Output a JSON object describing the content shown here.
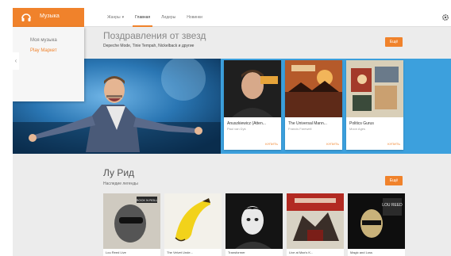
{
  "app": {
    "name": "Музыка",
    "icon": "headphones-icon"
  },
  "nav": {
    "tabs": [
      {
        "label": "Жанры",
        "caret": "▾"
      },
      {
        "label": "Главная",
        "active": true
      },
      {
        "label": "Лидеры"
      },
      {
        "label": "Новинки"
      }
    ]
  },
  "sidemenu": {
    "items": [
      "Моя музыка",
      "Play Маркет"
    ]
  },
  "collapse_glyph": "‹",
  "featured": {
    "title": "Поздравления от звезд",
    "subtitle": "Depeche Mode, Tinie Tempah, Nickelback и другие",
    "more_label": "Ещё",
    "albums": [
      {
        "title": "Anuszkiewicz (Atten...",
        "artist": "Paul van Dyk",
        "price": "КУПИТЬ"
      },
      {
        "title": "The Universal Mann...",
        "artist": "Francis Farewell",
        "price": "КУПИТЬ"
      },
      {
        "title": "Politics Gurus",
        "artist": "Moon Ages",
        "price": "КУПИТЬ"
      }
    ]
  },
  "artist_section": {
    "title": "Лу Рид",
    "subtitle": "Наследие легенды",
    "more_label": "Ещё",
    "albums": [
      {
        "title": "Lou Reed Live",
        "cover_text": "ROCK N ROLL"
      },
      {
        "title": "The Velvet Unde..."
      },
      {
        "title": "Transformer"
      },
      {
        "title": "Live at Max's K..."
      },
      {
        "title": "Magic and Loss",
        "cover_text": "LOU REED"
      }
    ]
  },
  "colors": {
    "accent": "#f0822b",
    "hero_band": "#3ca0dd",
    "background": "#ececec"
  }
}
